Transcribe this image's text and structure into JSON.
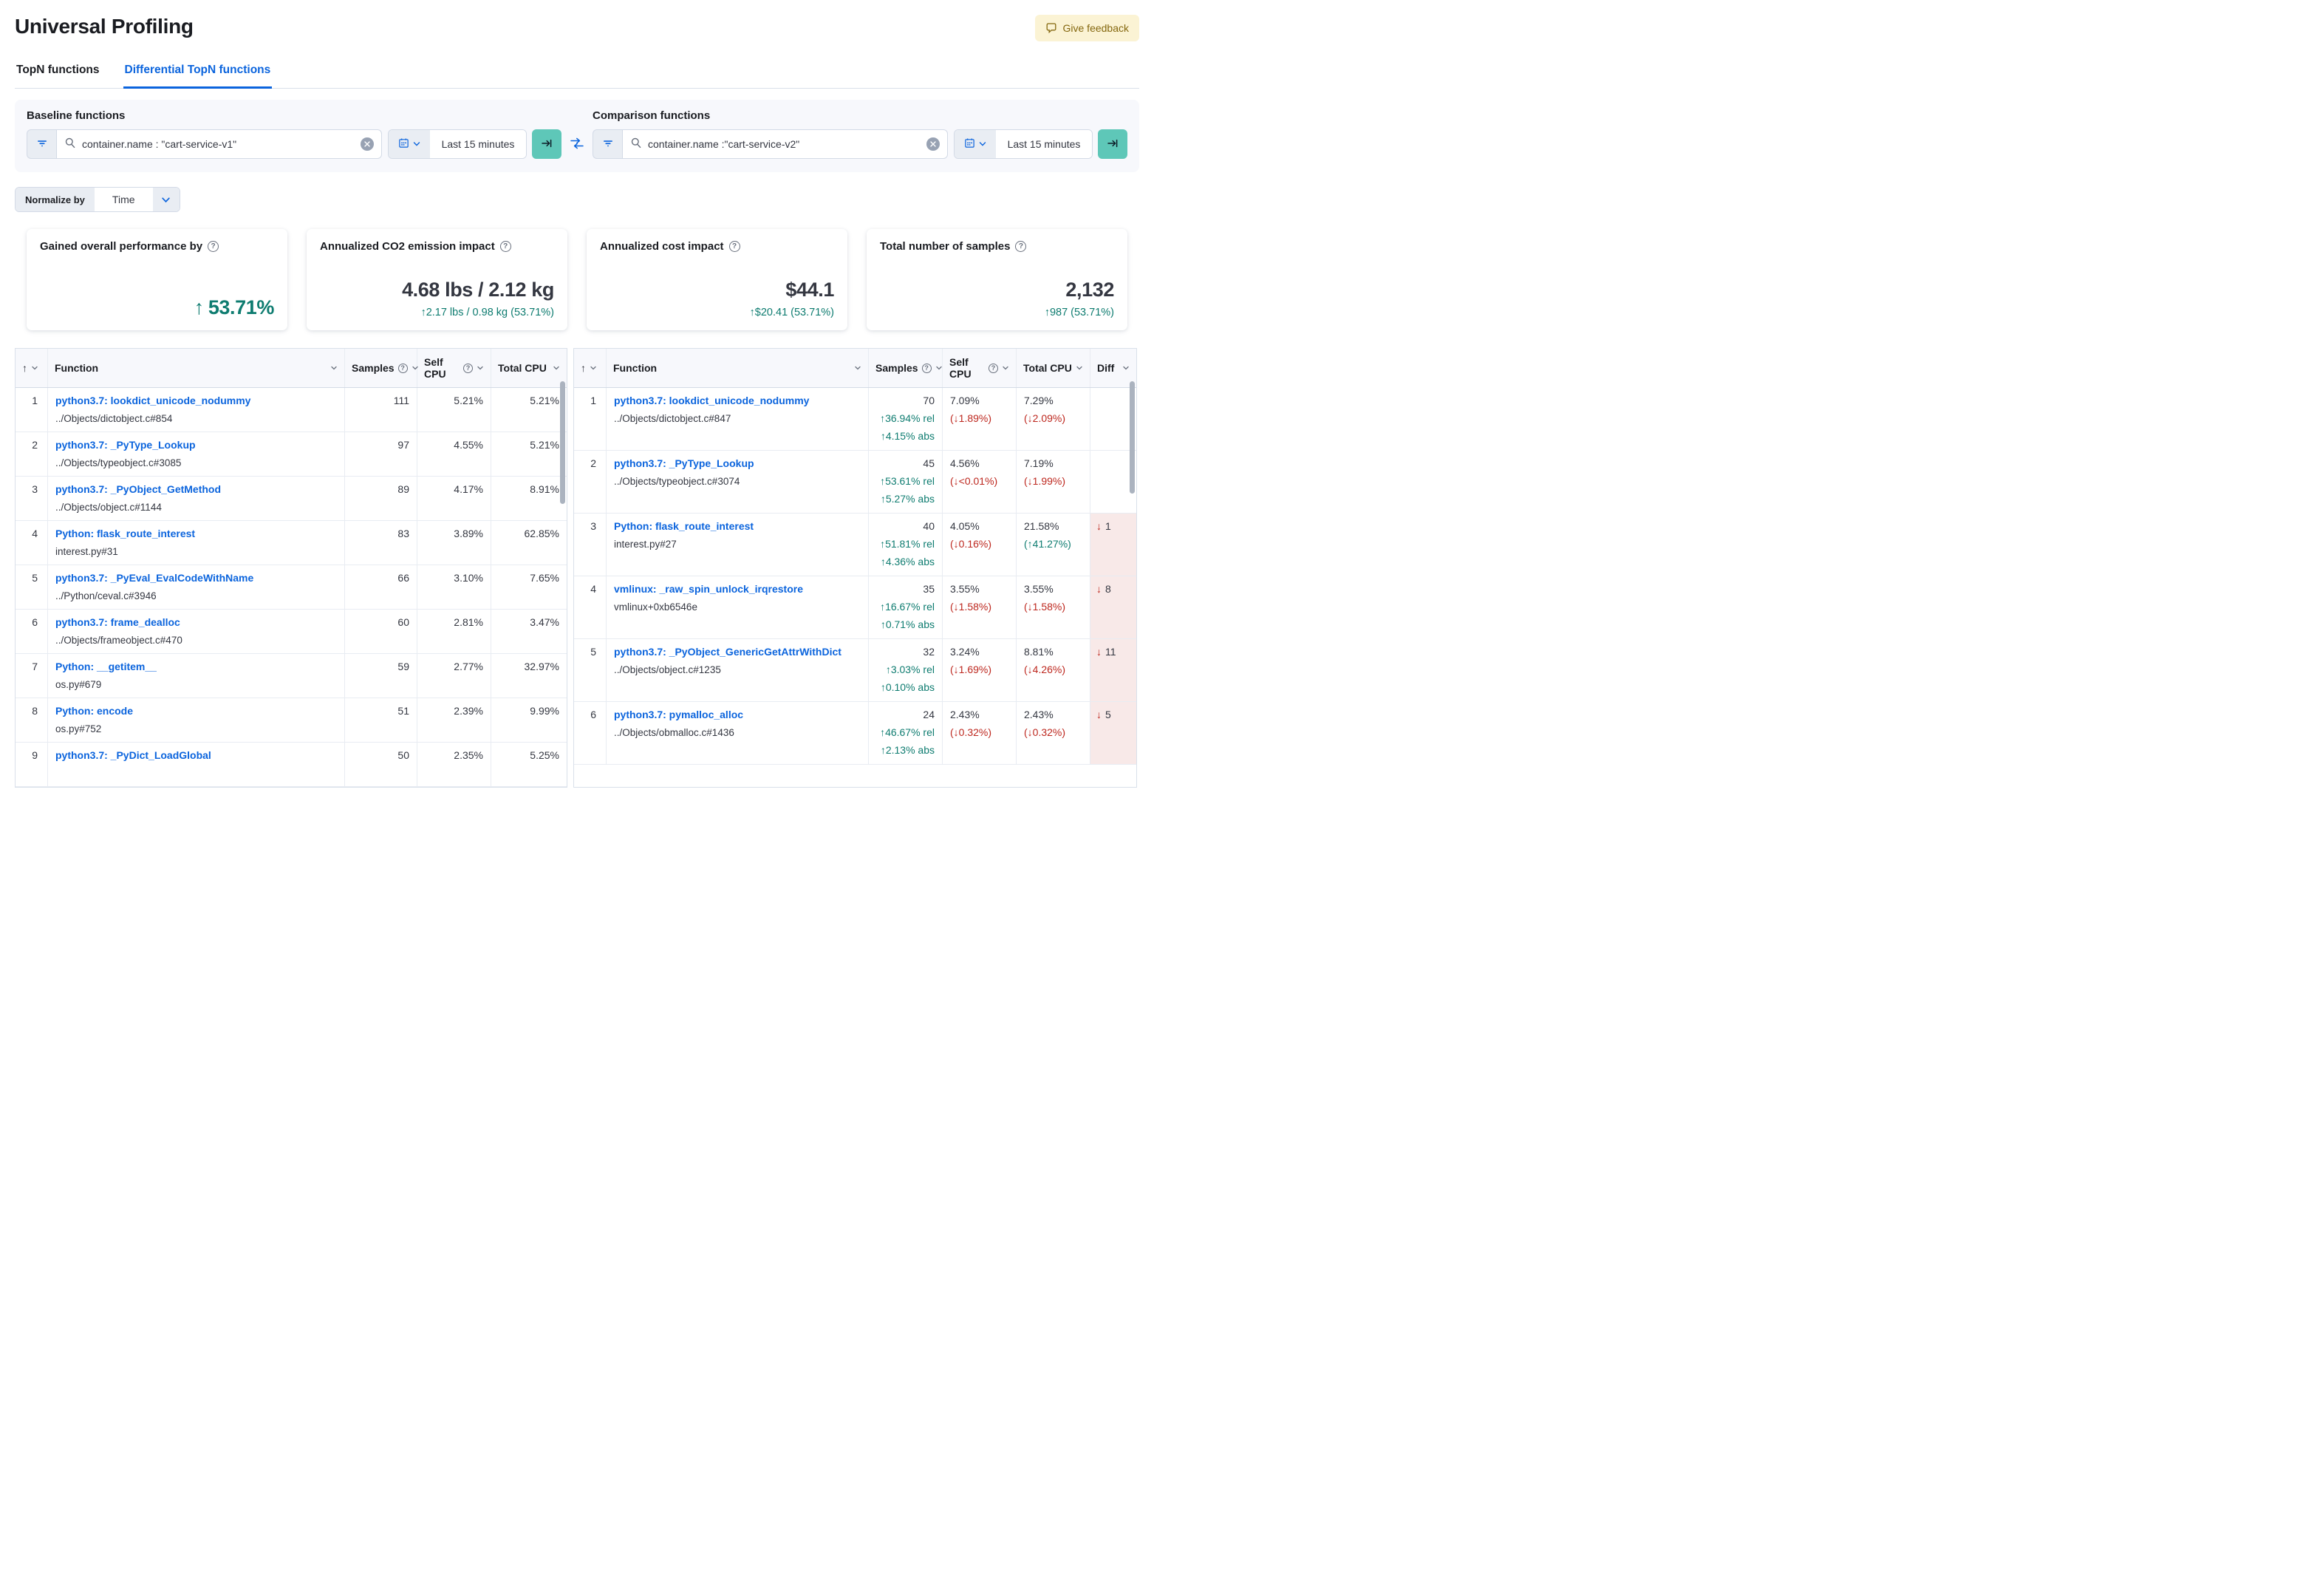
{
  "page": {
    "title": "Universal Profiling"
  },
  "feedback_button": {
    "label": "Give feedback"
  },
  "tabs": [
    {
      "label": "TopN functions",
      "active": false
    },
    {
      "label": "Differential TopN functions",
      "active": true
    }
  ],
  "baseline": {
    "label": "Baseline functions",
    "query": "container.name : \"cart-service-v1\"",
    "time_range": "Last 15 minutes"
  },
  "comparison": {
    "label": "Comparison functions",
    "query": "container.name :\"cart-service-v2\"",
    "time_range": "Last 15 minutes"
  },
  "normalize": {
    "label": "Normalize by",
    "value": "Time"
  },
  "summary_cards": [
    {
      "title": "Gained overall performance by",
      "arrow": "↑",
      "value": "53.71%",
      "change": ""
    },
    {
      "title": "Annualized CO2 emission impact",
      "arrow": "",
      "value": "4.68 lbs / 2.12 kg",
      "change": "↑2.17 lbs / 0.98 kg (53.71%)"
    },
    {
      "title": "Annualized cost impact",
      "arrow": "",
      "value": "$44.1",
      "change": "↑$20.41 (53.71%)"
    },
    {
      "title": "Total number of samples",
      "arrow": "",
      "value": "2,132",
      "change": "↑987 (53.71%)"
    }
  ],
  "baseline_table": {
    "columns": [
      "Function",
      "Samples",
      "Self CPU",
      "Total CPU"
    ],
    "rows": [
      {
        "rank": "1",
        "function": "python3.7: lookdict_unicode_nodummy",
        "source": "../Objects/dictobject.c#854",
        "samples": "111",
        "self_cpu": "5.21%",
        "total_cpu": "5.21%"
      },
      {
        "rank": "2",
        "function": "python3.7: _PyType_Lookup",
        "source": "../Objects/typeobject.c#3085",
        "samples": "97",
        "self_cpu": "4.55%",
        "total_cpu": "5.21%"
      },
      {
        "rank": "3",
        "function": "python3.7: _PyObject_GetMethod",
        "source": "../Objects/object.c#1144",
        "samples": "89",
        "self_cpu": "4.17%",
        "total_cpu": "8.91%"
      },
      {
        "rank": "4",
        "function": "Python: flask_route_interest",
        "source": "interest.py#31",
        "samples": "83",
        "self_cpu": "3.89%",
        "total_cpu": "62.85%"
      },
      {
        "rank": "5",
        "function": "python3.7: _PyEval_EvalCodeWithName",
        "source": "../Python/ceval.c#3946",
        "samples": "66",
        "self_cpu": "3.10%",
        "total_cpu": "7.65%"
      },
      {
        "rank": "6",
        "function": "python3.7: frame_dealloc",
        "source": "../Objects/frameobject.c#470",
        "samples": "60",
        "self_cpu": "2.81%",
        "total_cpu": "3.47%"
      },
      {
        "rank": "7",
        "function": "Python: __getitem__",
        "source": "os.py#679",
        "samples": "59",
        "self_cpu": "2.77%",
        "total_cpu": "32.97%"
      },
      {
        "rank": "8",
        "function": "Python: encode",
        "source": "os.py#752",
        "samples": "51",
        "self_cpu": "2.39%",
        "total_cpu": "9.99%"
      },
      {
        "rank": "9",
        "function": "python3.7: _PyDict_LoadGlobal",
        "source": "",
        "samples": "50",
        "self_cpu": "2.35%",
        "total_cpu": "5.25%"
      }
    ]
  },
  "comparison_table": {
    "columns": [
      "Function",
      "Samples",
      "Self CPU",
      "Total CPU",
      "Diff"
    ],
    "rows": [
      {
        "rank": "1",
        "function": "python3.7: lookdict_unicode_nodummy",
        "source": "../Objects/dictobject.c#847",
        "samples": "70",
        "samples_rel": "↑36.94% rel",
        "samples_abs": "↑4.15% abs",
        "self_cpu": "7.09%",
        "self_change": "(↓1.89%)",
        "self_tone": "neg",
        "total_cpu": "7.29%",
        "total_change": "(↓2.09%)",
        "total_tone": "neg",
        "diff": ""
      },
      {
        "rank": "2",
        "function": "python3.7: _PyType_Lookup",
        "source": "../Objects/typeobject.c#3074",
        "samples": "45",
        "samples_rel": "↑53.61% rel",
        "samples_abs": "↑5.27% abs",
        "self_cpu": "4.56%",
        "self_change": "(↓<0.01%)",
        "self_tone": "neg",
        "total_cpu": "7.19%",
        "total_change": "(↓1.99%)",
        "total_tone": "neg",
        "diff": ""
      },
      {
        "rank": "3",
        "function": "Python: flask_route_interest",
        "source": "interest.py#27",
        "samples": "40",
        "samples_rel": "↑51.81% rel",
        "samples_abs": "↑4.36% abs",
        "self_cpu": "4.05%",
        "self_change": "(↓0.16%)",
        "self_tone": "neg",
        "total_cpu": "21.58%",
        "total_change": "(↑41.27%)",
        "total_tone": "pos",
        "diff": "1",
        "diff_has": "1"
      },
      {
        "rank": "4",
        "function": "vmlinux: _raw_spin_unlock_irqrestore",
        "source": "vmlinux+0xb6546e",
        "samples": "35",
        "samples_rel": "↑16.67% rel",
        "samples_abs": "↑0.71% abs",
        "self_cpu": "3.55%",
        "self_change": "(↓1.58%)",
        "self_tone": "neg",
        "total_cpu": "3.55%",
        "total_change": "(↓1.58%)",
        "total_tone": "neg",
        "diff": "8",
        "diff_has": "1"
      },
      {
        "rank": "5",
        "function": "python3.7: _PyObject_GenericGetAttrWithDict",
        "source": "../Objects/object.c#1235",
        "samples": "32",
        "samples_rel": "↑3.03% rel",
        "samples_abs": "↑0.10% abs",
        "self_cpu": "3.24%",
        "self_change": "(↓1.69%)",
        "self_tone": "neg",
        "total_cpu": "8.81%",
        "total_change": "(↓4.26%)",
        "total_tone": "neg",
        "diff": "11",
        "diff_has": "1"
      },
      {
        "rank": "6",
        "function": "python3.7: pymalloc_alloc",
        "source": "../Objects/obmalloc.c#1436",
        "samples": "24",
        "samples_rel": "↑46.67% rel",
        "samples_abs": "↑2.13% abs",
        "self_cpu": "2.43%",
        "self_change": "(↓0.32%)",
        "self_tone": "neg",
        "total_cpu": "2.43%",
        "total_change": "(↓0.32%)",
        "total_tone": "neg",
        "diff": "5",
        "diff_has": "1"
      }
    ]
  }
}
